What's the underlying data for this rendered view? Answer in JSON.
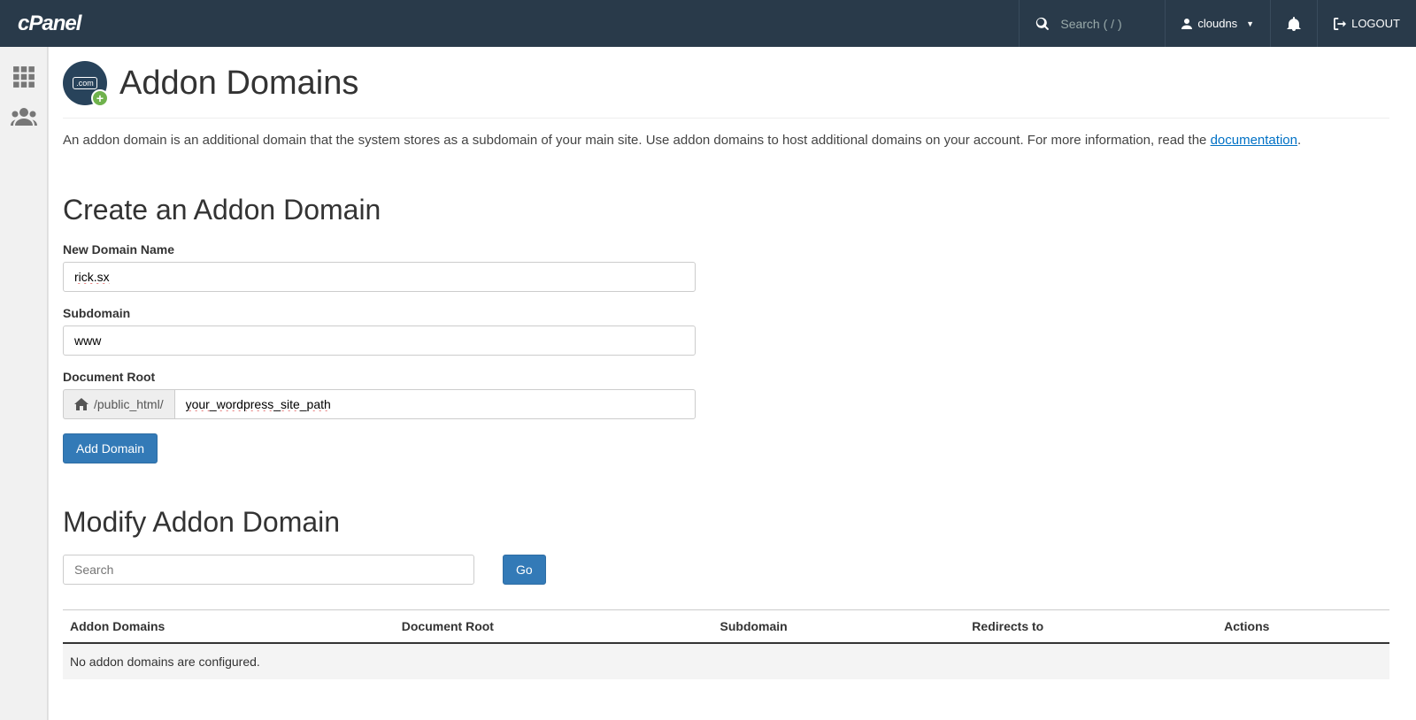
{
  "topbar": {
    "logo_text": "cPanel",
    "search_placeholder": "Search ( / )",
    "username": "cloudns",
    "logout_label": "LOGOUT"
  },
  "page": {
    "title": "Addon Domains",
    "intro_text": "An addon domain is an additional domain that the system stores as a subdomain of your main site. Use addon domains to host additional domains on your account. For more information, read the ",
    "intro_link": "documentation",
    "intro_suffix": "."
  },
  "create": {
    "heading": "Create an Addon Domain",
    "new_domain_label": "New Domain Name",
    "new_domain_value": "rick.sx",
    "subdomain_label": "Subdomain",
    "subdomain_value": "www",
    "docroot_label": "Document Root",
    "docroot_prefix": "/public_html/",
    "docroot_value": "your_wordpress_site_path",
    "submit_label": "Add Domain"
  },
  "modify": {
    "heading": "Modify Addon Domain",
    "search_placeholder": "Search",
    "go_label": "Go",
    "columns": {
      "addon": "Addon Domains",
      "docroot": "Document Root",
      "subdomain": "Subdomain",
      "redirects": "Redirects to",
      "actions": "Actions"
    },
    "empty_text": "No addon domains are configured."
  }
}
